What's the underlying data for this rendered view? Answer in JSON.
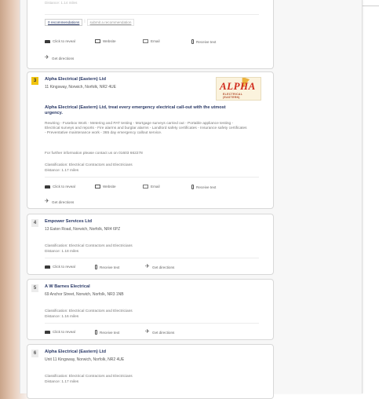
{
  "page": {
    "cards": [
      {
        "faded_text": "Distance: 1.14 miles",
        "recommendations_label": "0 recommendations",
        "submit_label": "submit a recommendation",
        "actions": [
          "Click to reveal",
          "Website",
          "Email",
          "Receive text",
          "Get directions"
        ]
      },
      {
        "number": "3",
        "title": "Alpha Electrical (Eastern) Ltd",
        "address": "11 Kingsway, Norwich, Norfolk, NR2 4UE",
        "logo_text": "ALPHA",
        "logo_subtext": "ELECTRICAL (EASTERN)",
        "desc_heading": "Alpha Electrical (Eastern) Ltd, treat every emergency electrical call-out with the utmost urgency.",
        "desc": "Rewiring - Fusebox Work - Metering and PAT testing - Mortgage surveys carried out - Portable appliance testing - Electrical surveys and reports - Fire alarms and burglar alarms - Landlord safety certificates - Insurance safety certificates - Preventative maintenance work - 365 day emergency callout service.",
        "info": "For further information please contact us on 01603 662278",
        "classification": "Classification: Electrical Contractors and Electricians",
        "distance": "Distance: 1.17 miles",
        "actions": [
          "Click to reveal",
          "Website",
          "Email",
          "Receive text",
          "Get directions"
        ]
      },
      {
        "number": "4",
        "title": "Empower Services Ltd",
        "address": "13 Eaton Road, Norwich, Norfolk, NR4 6PZ",
        "classification": "Classification: Electrical Contractors and Electricians",
        "distance": "Distance: 1.18 miles",
        "actions": [
          "Click to reveal",
          "Receive text",
          "Get directions"
        ]
      },
      {
        "number": "5",
        "title": "A W Barnes Electrical",
        "address": "69 Anchor Street, Norwich, Norfolk, NR3 1NB",
        "classification": "Classification: Electrical Contractors and Electricians",
        "distance": "Distance: 1.16 miles",
        "actions": [
          "Click to reveal",
          "Receive text",
          "Get directions"
        ]
      },
      {
        "number": "6",
        "title": "Alpha Electrical (Eastern) Ltd",
        "address": "Unit 11 Kingsway, Norwich, Norfolk, NR2 4UE",
        "classification": "Classification: Electrical Contractors and Electricians",
        "distance": "Distance: 1.17 miles"
      }
    ]
  }
}
